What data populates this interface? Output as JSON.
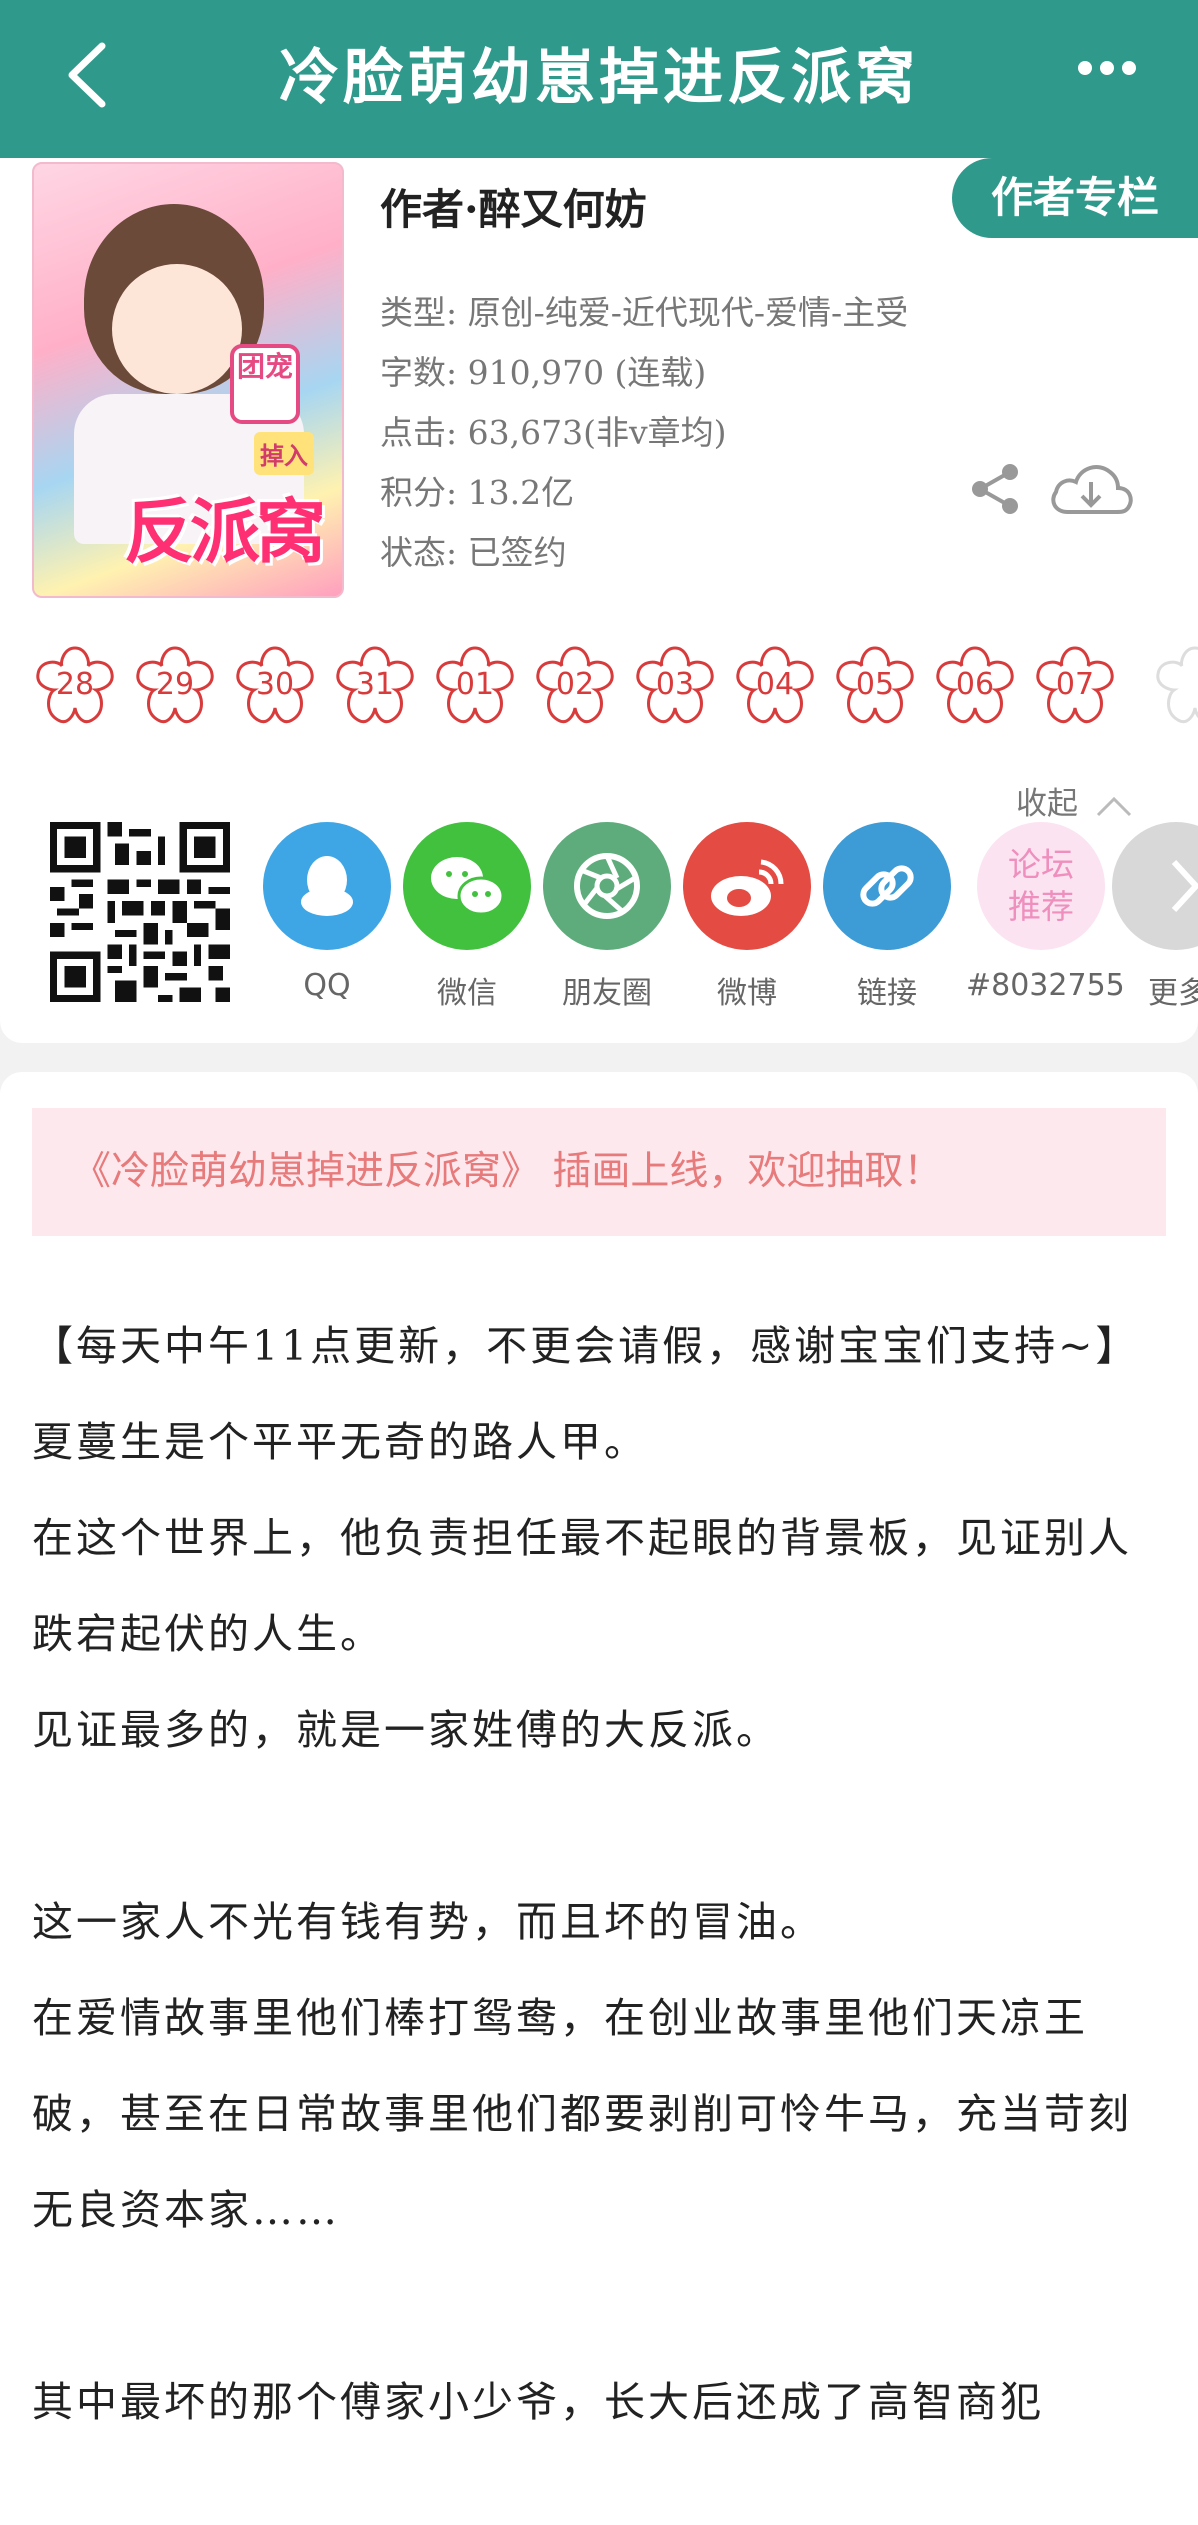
{
  "header": {
    "title": "冷脸萌幼崽掉进反派窝",
    "back_icon": "chevron-left-icon",
    "more_icon": "more-dots-icon"
  },
  "book": {
    "cover_text": {
      "sign": "团宠",
      "big": "反派窝",
      "fall": "掉入"
    },
    "author": "作者·醉又何妨",
    "author_column_label": "作者专栏",
    "info": [
      "类型: 原创-纯爱-近代现代-爱情-主受",
      "字数: 910,970 (连载)",
      "点击: 63,673(非v章均)",
      "积分: 13.2亿",
      "状态: 已签约"
    ]
  },
  "update_dates": [
    "28",
    "29",
    "30",
    "31",
    "01",
    "02",
    "03",
    "04",
    "05",
    "06",
    "07"
  ],
  "share": {
    "collapse_label": "收起",
    "items": [
      {
        "label": "QQ",
        "icon": "qq-icon",
        "color": "#3fa6e6"
      },
      {
        "label": "微信",
        "icon": "wechat-icon",
        "color": "#42c13f"
      },
      {
        "label": "朋友圈",
        "icon": "moments-icon",
        "color": "#5eac7c"
      },
      {
        "label": "微博",
        "icon": "weibo-icon",
        "color": "#e44b43"
      },
      {
        "label": "链接",
        "icon": "link-icon",
        "color": "#3d9bd6"
      },
      {
        "label": "#8032755",
        "icon_text": "论坛\n推荐",
        "color": "#fbe3f1"
      },
      {
        "label": "更多",
        "icon": "chevron-right-icon",
        "color": "#d8d8d8"
      }
    ]
  },
  "banner": "《冷脸萌幼崽掉进反派窝》 插画上线，欢迎抽取！",
  "description": [
    "【每天中午11点更新，不更会请假，感谢宝宝们支持~】",
    "夏蔓生是个平平无奇的路人甲。",
    "在这个世界上，他负责担任最不起眼的背景板，见证别人跌宕起伏的人生。",
    "见证最多的，就是一家姓傅的大反派。",
    "",
    "这一家人不光有钱有势，而且坏的冒油。",
    "在爱情故事里他们棒打鸳鸯，在创业故事里他们天凉王破，甚至在日常故事里他们都要剥削可怜牛马，充当苛刻无良资本家……",
    "",
    "其中最坏的那个傅家小少爷，长大后还成了高智商犯"
  ]
}
